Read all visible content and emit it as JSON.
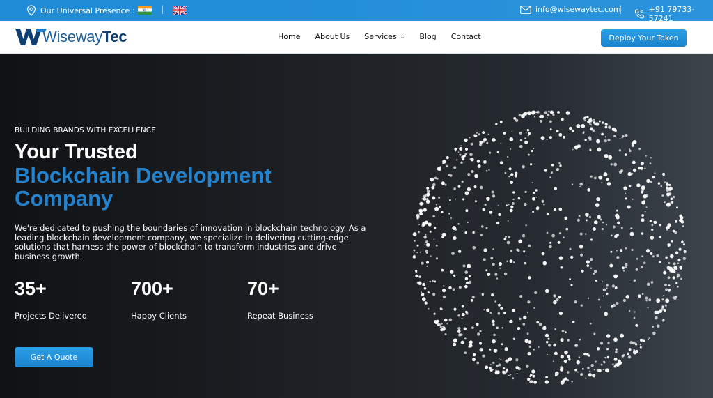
{
  "topbar": {
    "presence_label": "Our Universal Presence :",
    "separator": "|",
    "email": "info@wisewaytec.com",
    "phone": "+91 79733-57241"
  },
  "brand": {
    "name_part1": "Wiseway",
    "name_part2": "Tec"
  },
  "nav": {
    "items": [
      "Home",
      "About Us",
      "Services",
      "Blog",
      "Contact"
    ],
    "cta": "Deploy Your Token"
  },
  "hero": {
    "eyebrow": "BUILDING BRANDS WITH EXCELLENCE",
    "title_line1": "Your Trusted",
    "title_line2": "Blockchain Development",
    "title_line3": "Company",
    "description": "We're dedicated to pushing the boundaries of innovation in blockchain technology. As a leading blockchain development company, we specialize in delivering cutting-edge solutions that harness the power of blockchain to transform industries and drive business growth.",
    "stats": [
      {
        "value": "35+",
        "label": "Projects Delivered"
      },
      {
        "value": "700+",
        "label": "Happy Clients"
      },
      {
        "value": "70+",
        "label": "Repeat Business"
      }
    ],
    "cta": "Get A Quote"
  },
  "colors": {
    "accent": "#2383cf",
    "topbar": "#1f8bd6"
  }
}
